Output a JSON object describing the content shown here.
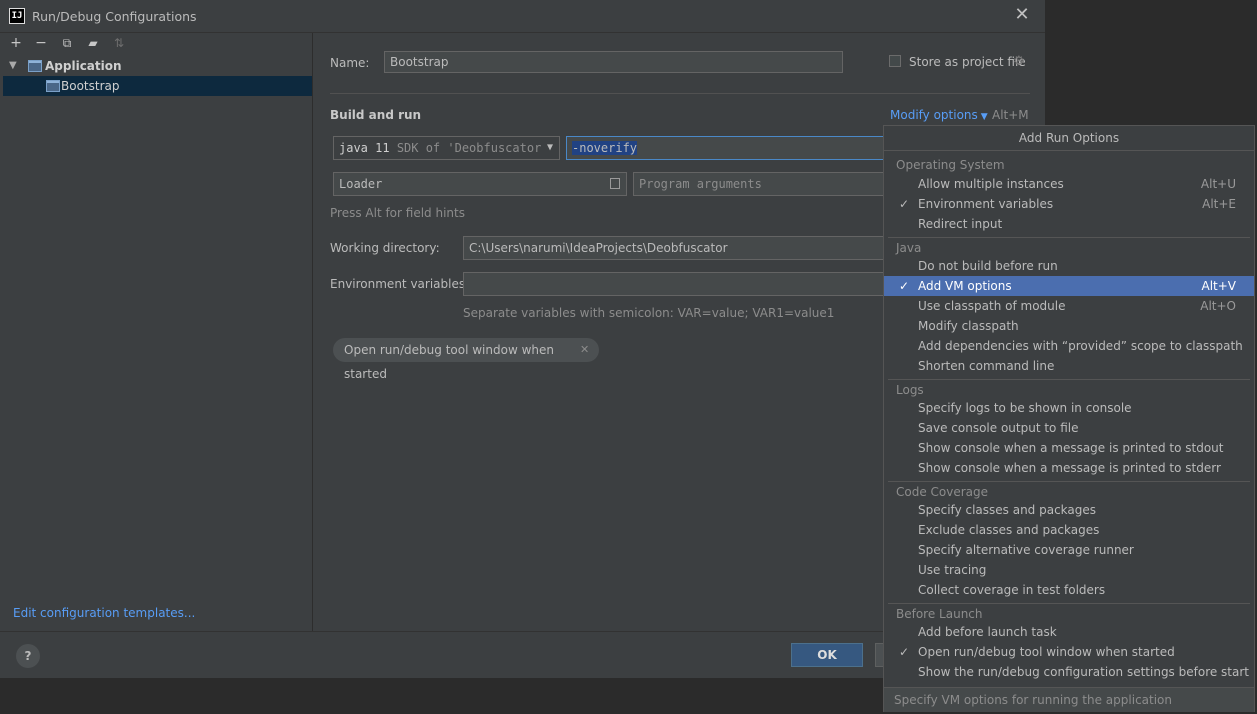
{
  "window": {
    "title": "Run/Debug Configurations",
    "app_icon": "IJ"
  },
  "toolbar": {
    "add": "+",
    "remove": "−",
    "copy": "⧉",
    "folder": "▰",
    "sort": "⇅"
  },
  "tree": {
    "group": "Application",
    "item": "Bootstrap"
  },
  "edit_templates": "Edit configuration templates...",
  "name_label": "Name:",
  "name_value": "Bootstrap",
  "store_label": "Store as project file",
  "build_and_run": "Build and run",
  "modify_options": "Modify options",
  "modify_shortcut": "Alt+M",
  "sdk": {
    "name": "java 11",
    "detail": "SDK of 'Deobfuscator"
  },
  "vm_options": "-noverify",
  "main_class": "Loader",
  "program_args_placeholder": "Program arguments",
  "alt_hint": "Press Alt for field hints",
  "working_dir_label": "Working directory:",
  "working_dir_value": "C:\\Users\\narumi\\IdeaProjects\\Deobfuscator",
  "env_label": "Environment variables:",
  "env_hint": "Separate variables with semicolon: VAR=value; VAR1=value1",
  "chip_label": "Open run/debug tool window when started",
  "ok": "OK",
  "help": "?",
  "popup": {
    "title": "Add Run Options",
    "footer": "Specify VM options for running the application",
    "sections": [
      {
        "title": "Operating System",
        "items": [
          {
            "label": "Allow multiple instances",
            "shortcut": "Alt+U",
            "checked": false
          },
          {
            "label": "Environment variables",
            "shortcut": "Alt+E",
            "checked": true
          },
          {
            "label": "Redirect input",
            "shortcut": "",
            "checked": false
          }
        ]
      },
      {
        "title": "Java",
        "items": [
          {
            "label": "Do not build before run",
            "shortcut": "",
            "checked": false
          },
          {
            "label": "Add VM options",
            "shortcut": "Alt+V",
            "checked": true,
            "selected": true
          },
          {
            "label": "Use classpath of module",
            "shortcut": "Alt+O",
            "checked": false
          },
          {
            "label": "Modify classpath",
            "shortcut": "",
            "checked": false
          },
          {
            "label": "Add dependencies with “provided” scope to classpath",
            "shortcut": "",
            "checked": false
          },
          {
            "label": "Shorten command line",
            "shortcut": "",
            "checked": false
          }
        ]
      },
      {
        "title": "Logs",
        "items": [
          {
            "label": "Specify logs to be shown in console",
            "shortcut": "",
            "checked": false
          },
          {
            "label": "Save console output to file",
            "shortcut": "",
            "checked": false
          },
          {
            "label": "Show console when a message is printed to stdout",
            "shortcut": "",
            "checked": false
          },
          {
            "label": "Show console when a message is printed to stderr",
            "shortcut": "",
            "checked": false
          }
        ]
      },
      {
        "title": "Code Coverage",
        "items": [
          {
            "label": "Specify classes and packages",
            "shortcut": "",
            "checked": false
          },
          {
            "label": "Exclude classes and packages",
            "shortcut": "",
            "checked": false
          },
          {
            "label": "Specify alternative coverage runner",
            "shortcut": "",
            "checked": false
          },
          {
            "label": "Use tracing",
            "shortcut": "",
            "checked": false
          },
          {
            "label": "Collect coverage in test folders",
            "shortcut": "",
            "checked": false
          }
        ]
      },
      {
        "title": "Before Launch",
        "items": [
          {
            "label": "Add before launch task",
            "shortcut": "",
            "checked": false
          },
          {
            "label": "Open run/debug tool window when started",
            "shortcut": "",
            "checked": true
          },
          {
            "label": "Show the run/debug configuration settings before start",
            "shortcut": "",
            "checked": false
          }
        ]
      }
    ]
  },
  "colors": {
    "bg": "#3c3f41",
    "accent": "#4b6eaf",
    "link": "#589df6",
    "ok": "#365880"
  }
}
